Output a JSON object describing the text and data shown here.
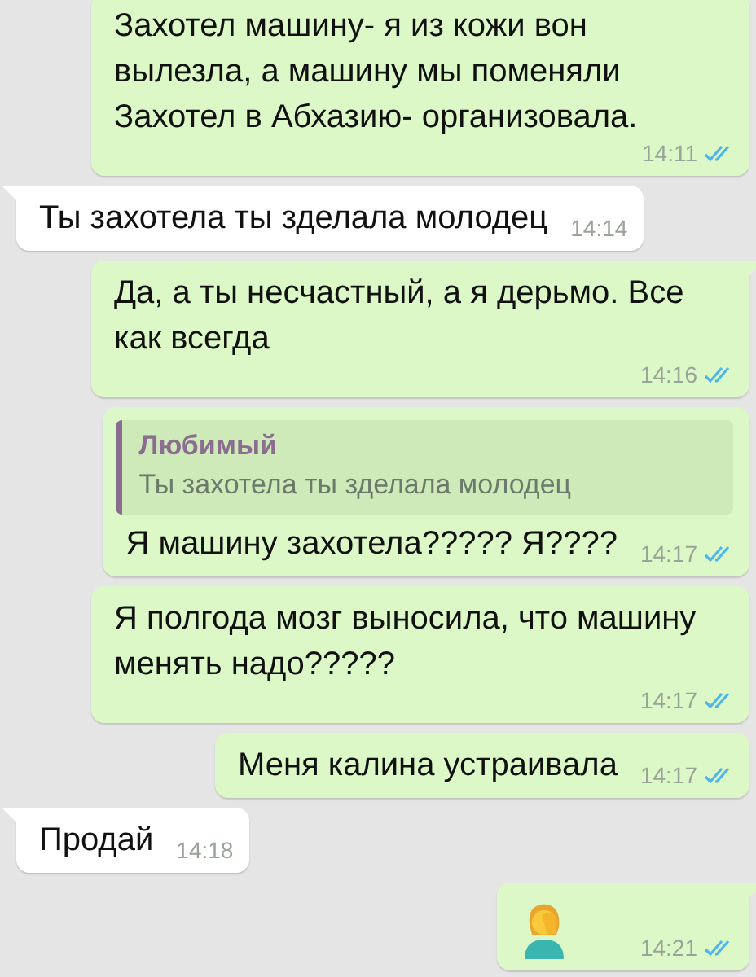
{
  "messages": [
    {
      "kind": "text",
      "outgoing": true,
      "tail": false,
      "text": "Захотел машину- я из кожи вон вылезла, а машину мы поменяли Захотел в Абхазию- организовала.",
      "time": "14:11",
      "read": true
    },
    {
      "kind": "text",
      "outgoing": false,
      "tail": true,
      "text": "Ты захотела ты зделала молодец",
      "time": "14:14"
    },
    {
      "kind": "text",
      "outgoing": true,
      "tail": true,
      "text": "Да, а ты несчастный, а я дерьмо.  Все как всегда",
      "time": "14:16",
      "read": true
    },
    {
      "kind": "text",
      "outgoing": true,
      "tail": false,
      "quote": {
        "author": "Любимый",
        "text": "Ты захотела ты зделала молодец"
      },
      "text": "Я машину захотела????? Я????",
      "time": "14:17",
      "read": true
    },
    {
      "kind": "text",
      "outgoing": true,
      "tail": false,
      "text": "Я полгода мозг выносила, что машину менять надо?????",
      "time": "14:17",
      "read": true
    },
    {
      "kind": "text",
      "outgoing": true,
      "tail": false,
      "text": "Меня калина устраивала",
      "time": "14:17",
      "read": true
    },
    {
      "kind": "text",
      "outgoing": false,
      "tail": true,
      "text": "Продай",
      "time": "14:18"
    },
    {
      "kind": "sticker",
      "outgoing": true,
      "tail": true,
      "time": "14:21",
      "read": true
    }
  ]
}
